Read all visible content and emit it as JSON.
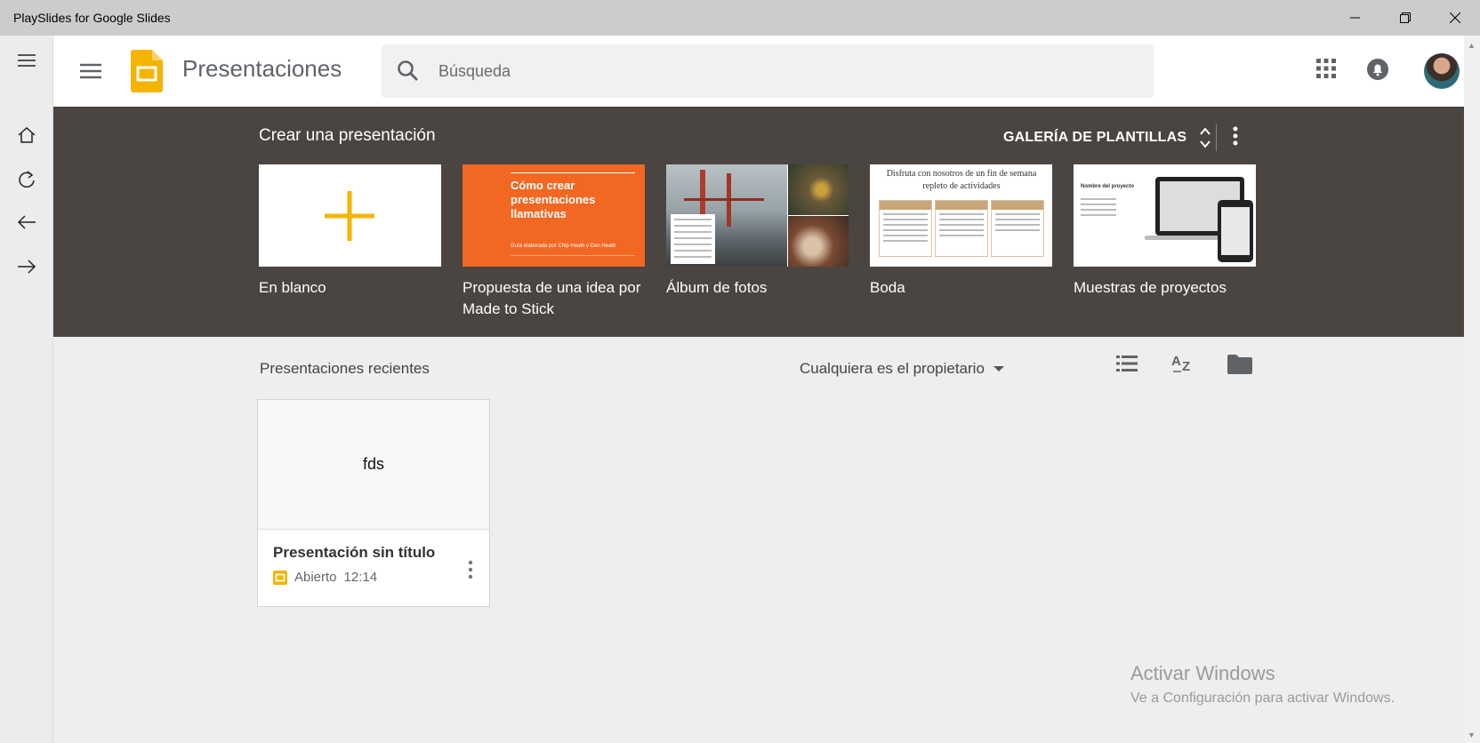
{
  "window": {
    "title": "PlaySlides for Google Slides",
    "controls": [
      "minimize-icon",
      "restore-icon",
      "close-icon"
    ]
  },
  "rail": {
    "items": [
      "menu-icon",
      "home-icon",
      "refresh-icon",
      "back-arrow-icon",
      "forward-arrow-icon"
    ]
  },
  "header": {
    "app_title": "Presentaciones",
    "search_placeholder": "Búsqueda",
    "icons": [
      "hamburger-icon",
      "slides-logo-icon",
      "search-icon",
      "apps-grid-icon",
      "notifications-icon",
      "avatar"
    ]
  },
  "gallery": {
    "title": "Crear una presentación",
    "gallery_button": "GALERÍA DE PLANTILLAS",
    "templates": [
      {
        "label": "En blanco"
      },
      {
        "label": "Propuesta de una idea por Made to Stick",
        "thumb_title": "Cómo crear presentaciones llamativas",
        "thumb_sub": "Guía elaborada por Chip Heath y Dan Heath"
      },
      {
        "label": "Álbum de fotos"
      },
      {
        "label": "Boda",
        "thumb_title": "Disfruta con nosotros de un fin de semana repleto de actividades"
      },
      {
        "label": "Muestras de proyectos",
        "thumb_title": "Nombre del proyecto"
      }
    ],
    "colors": {
      "background": "#4a4541",
      "accent_orange": "#f26722",
      "plus_yellow": "#f4b400"
    }
  },
  "recent": {
    "title": "Presentaciones recientes",
    "owner_filter": "Cualquiera es el propietario",
    "view_icons": [
      "list-view-icon",
      "sort-az-icon",
      "folder-icon"
    ],
    "documents": [
      {
        "preview_text": "fds",
        "name": "Presentación sin título",
        "status": "Abierto",
        "time": "12:14"
      }
    ]
  },
  "watermark": {
    "line1": "Activar Windows",
    "line2": "Ve a Configuración para activar Windows."
  }
}
